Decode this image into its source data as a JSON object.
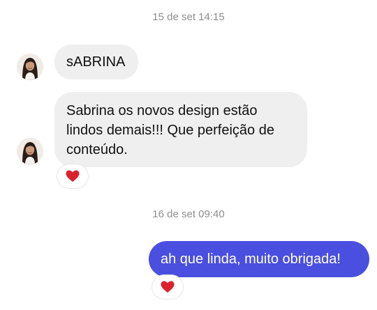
{
  "conversation": {
    "timestamps": [
      "15 de set 14:15",
      "16 de set 09:40"
    ],
    "messages": [
      {
        "sender": "incoming",
        "text": "sABRINA"
      },
      {
        "sender": "incoming",
        "text": "Sabrina os novos design estão lindos demais!!! Que perfeição de conteúdo.",
        "reaction": "heart-icon"
      },
      {
        "sender": "outgoing",
        "text": "ah que linda, muito obrigada!",
        "reaction": "heart-icon"
      }
    ]
  },
  "colors": {
    "incoming_bubble": "#efefef",
    "outgoing_bubble": "#4a4fe0",
    "timestamp_text": "#8e8e8e",
    "reaction_heart": "#d8232e"
  }
}
